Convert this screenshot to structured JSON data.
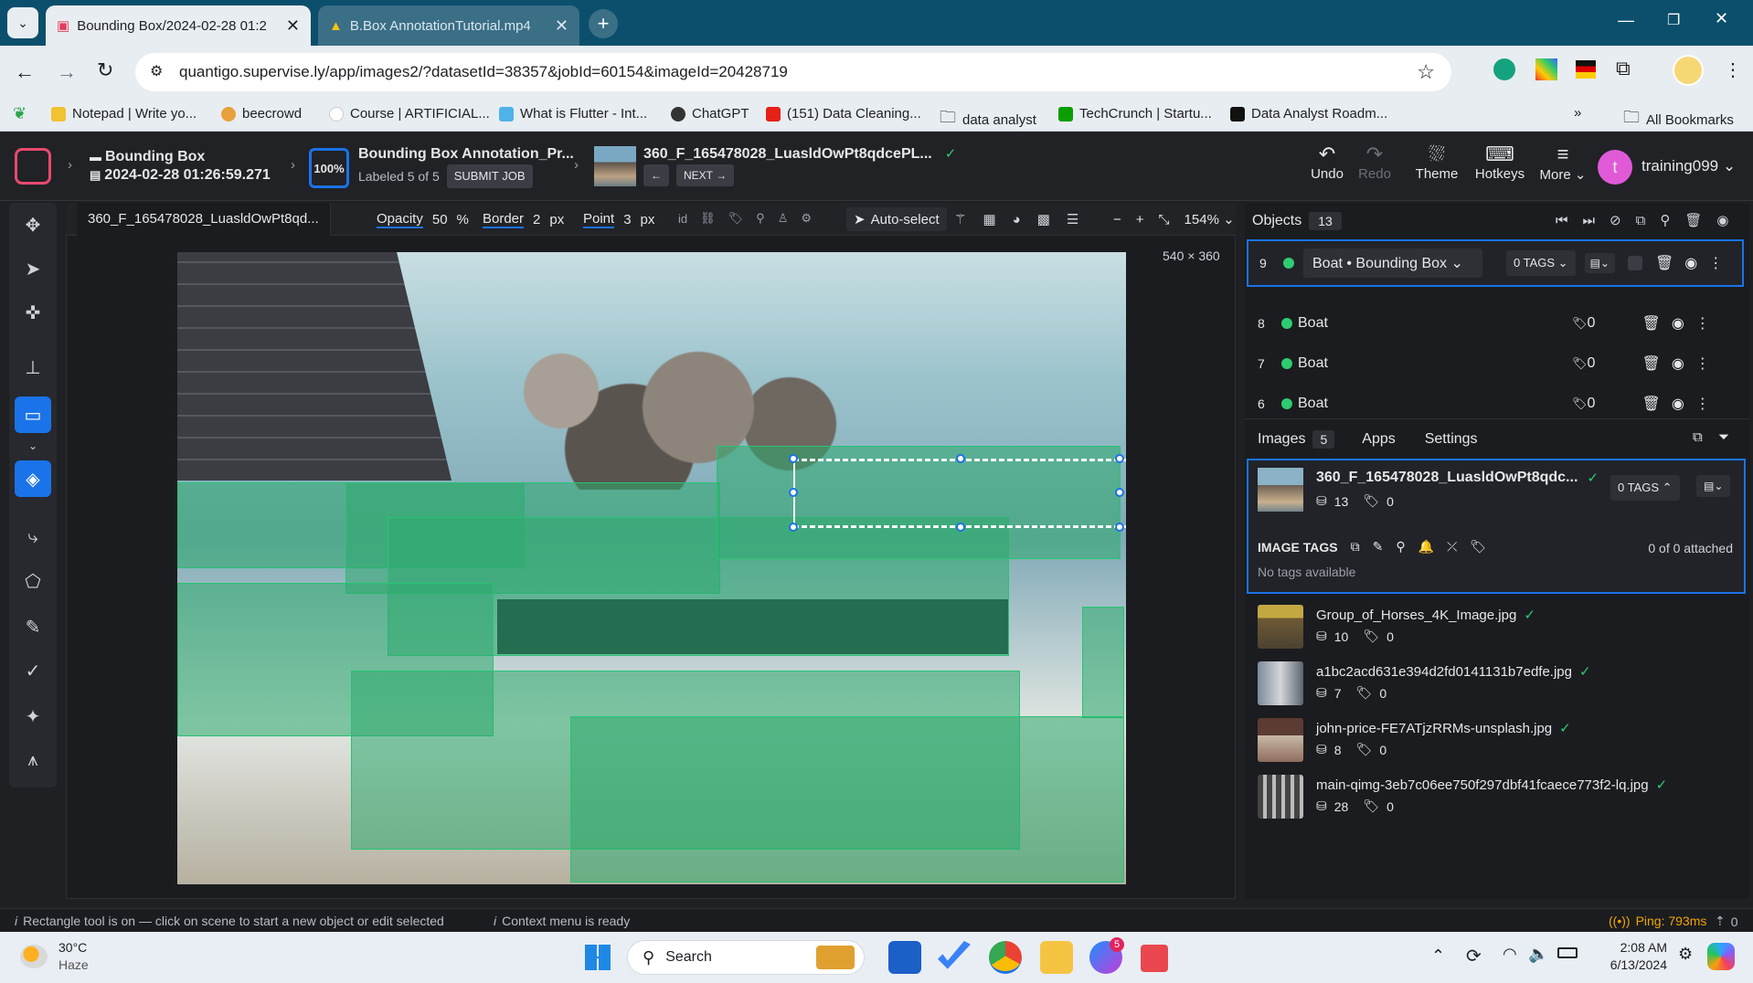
{
  "browser": {
    "tabs": [
      {
        "title": "Bounding Box/2024-02-28 01:2",
        "active": true
      },
      {
        "title": "B.Box AnnotationTutorial.mp4",
        "active": false
      }
    ],
    "url": "quantigo.supervise.ly/app/images2/?datasetId=38357&jobId=60154&imageId=20428719",
    "bookmarks": [
      "Notepad | Write yo...",
      "beecrowd",
      "Course | ARTIFICIAL...",
      "What is Flutter - Int...",
      "ChatGPT",
      "(151) Data Cleaning...",
      "data analyst",
      "TechCrunch | Startu...",
      "Data Analyst Roadm..."
    ],
    "all_bookmarks": "All Bookmarks"
  },
  "header": {
    "project_name": "Bounding Box",
    "dataset_date": "2024-02-28 01:26:59.271",
    "progress": "100%",
    "job_title": "Bounding Box Annotation_Pr...",
    "labeled": "Labeled 5 of 5",
    "submit": "SUBMIT JOB",
    "image_name": "360_F_165478028_LuasldOwPt8qdcePL...",
    "next": "NEXT",
    "undo": "Undo",
    "redo": "Redo",
    "theme": "Theme",
    "hotkeys": "Hotkeys",
    "more": "More",
    "user_initial": "t",
    "username": "training099"
  },
  "toolbar": {
    "image_tab": "360_F_165478028_LuasldOwPt8qd...",
    "opacity_label": "Opacity",
    "opacity_value": "50",
    "opacity_unit": "%",
    "border_label": "Border",
    "border_value": "2",
    "border_unit": "px",
    "point_label": "Point",
    "point_value": "3",
    "point_unit": "px",
    "autoselect": "Auto-select",
    "zoom": "154%",
    "dims": "540 × 360"
  },
  "objects": {
    "label": "Objects",
    "count": "13",
    "selected": {
      "id": "9",
      "class": "Boat • Bounding Box",
      "tags": "0 TAGS"
    },
    "rows": [
      {
        "id": "8",
        "name": "Boat",
        "tags": "0"
      },
      {
        "id": "7",
        "name": "Boat",
        "tags": "0"
      },
      {
        "id": "6",
        "name": "Boat",
        "tags": "0"
      }
    ]
  },
  "images": {
    "tab_label": "Images",
    "count": "5",
    "apps": "Apps",
    "settings": "Settings",
    "current": {
      "name": "360_F_165478028_LuasldOwPt8qdc...",
      "objects": "13",
      "tags": "0",
      "tag_btn": "0 TAGS"
    },
    "image_tags_label": "IMAGE TAGS",
    "attached": "0 of 0 attached",
    "no_tags": "No tags available",
    "list": [
      {
        "name": "Group_of_Horses_4K_Image.jpg",
        "objects": "10",
        "tags": "0"
      },
      {
        "name": "a1bc2acd631e394d2fd0141131b7edfe.jpg",
        "objects": "7",
        "tags": "0"
      },
      {
        "name": "john-price-FE7ATjzRRMs-unsplash.jpg",
        "objects": "8",
        "tags": "0"
      },
      {
        "name": "main-qimg-3eb7c06ee750f297dbf41fcaece773f2-lq.jpg",
        "objects": "28",
        "tags": "0"
      }
    ]
  },
  "status": {
    "left1": "Rectangle tool is on — click on scene to start a new object or edit selected",
    "left2": "Context menu is ready",
    "ping": "Ping: 793ms",
    "right": "0"
  },
  "taskbar": {
    "temp": "30°C",
    "weather": "Haze",
    "search": "Search",
    "time": "2:08 AM",
    "date": "6/13/2024",
    "messenger_badge": "5"
  },
  "colors": {
    "accent": "#1a73e8",
    "box": "#2eaa6e",
    "check": "#2ecc71"
  }
}
